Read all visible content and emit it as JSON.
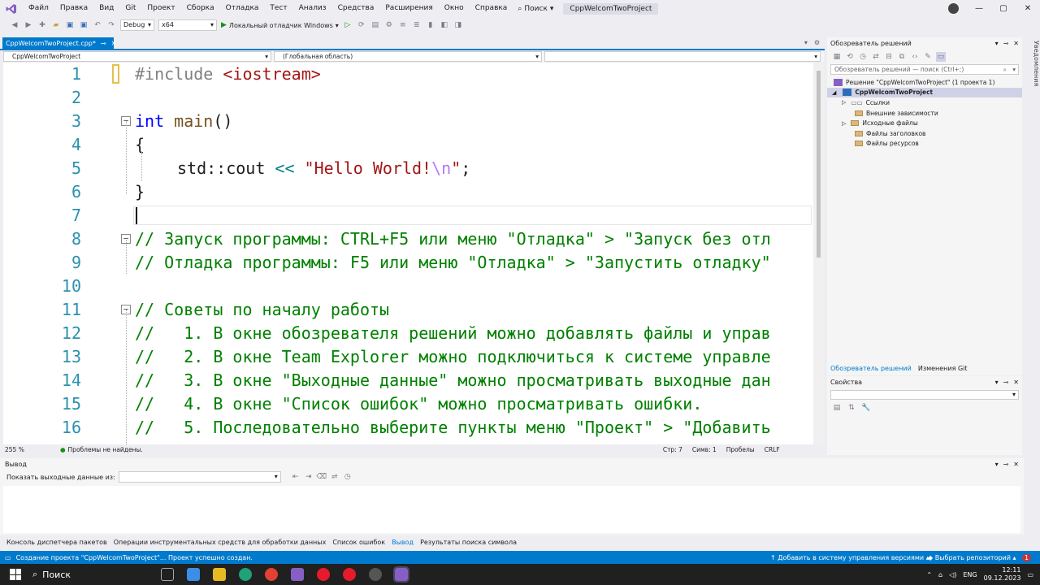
{
  "menu": {
    "items": [
      "Файл",
      "Правка",
      "Вид",
      "Git",
      "Проект",
      "Сборка",
      "Отладка",
      "Тест",
      "Анализ",
      "Средства",
      "Расширения",
      "Окно",
      "Справка"
    ],
    "search_label": "Поиск",
    "solution_title": "CppWelcomTwoProject"
  },
  "toolbar": {
    "config": "Debug",
    "platform": "x64",
    "run_label": "Локальный отладчик Windows"
  },
  "editor": {
    "tab_label": "CppWelcomTwoProject.cpp*",
    "nav_project": "CppWelcomTwoProject",
    "nav_scope": "(Глобальная область)",
    "lines": {
      "l1": {
        "num": "1",
        "pp": "#include ",
        "inc": "<iostream>"
      },
      "l2": {
        "num": "2"
      },
      "l3": {
        "num": "3",
        "kw": "int",
        "fn": "main",
        "rest": "()"
      },
      "l4": {
        "num": "4",
        "text": "{"
      },
      "l5": {
        "num": "5",
        "a": "std::cout ",
        "op": "<<",
        "s1": " \"Hello World!",
        "esc": "\\n",
        "s2": "\"",
        "end": ";"
      },
      "l6": {
        "num": "6",
        "text": "}"
      },
      "l7": {
        "num": "7"
      },
      "l8": {
        "num": "8",
        "text": "// Запуск программы: CTRL+F5 или меню \"Отладка\" > \"Запуск без отл"
      },
      "l9": {
        "num": "9",
        "text": "// Отладка программы: F5 или меню \"Отладка\" > \"Запустить отладку\""
      },
      "l10": {
        "num": "10"
      },
      "l11": {
        "num": "11",
        "text": "// Советы по началу работы"
      },
      "l12": {
        "num": "12",
        "text": "//   1. В окне обозревателя решений можно добавлять файлы и управ"
      },
      "l13": {
        "num": "13",
        "text": "//   2. В окне Team Explorer можно подключиться к системе управле"
      },
      "l14": {
        "num": "14",
        "text": "//   3. В окне \"Выходные данные\" можно просматривать выходные дан"
      },
      "l15": {
        "num": "15",
        "text": "//   4. В окне \"Список ошибок\" можно просматривать ошибки."
      },
      "l16": {
        "num": "16",
        "text": "//   5. Последовательно выберите пункты меню \"Проект\" > \"Добавить"
      }
    },
    "status": {
      "zoom": "255 %",
      "problems": "Проблемы не найдены.",
      "line": "Стр: 7",
      "col": "Симв: 1",
      "ws": "Пробелы",
      "eol": "CRLF"
    }
  },
  "solution_explorer": {
    "title": "Обозреватель решений",
    "search_placeholder": "Обозреватель решений — поиск (Ctrl+;)",
    "tree": {
      "solution": "Решение \"CppWelcomTwoProject\" (1 проекта 1)",
      "project": "CppWelcomTwoProject",
      "refs": "Ссылки",
      "ext": "Внешние зависимости",
      "src": "Исходные файлы",
      "hdr": "Файлы заголовков",
      "res": "Файлы ресурсов"
    },
    "tab_solution": "Обозреватель решений",
    "tab_git": "Изменения Git"
  },
  "properties": {
    "title": "Свойства"
  },
  "notifications": {
    "label": "Уведомления"
  },
  "output": {
    "title": "Вывод",
    "show_from": "Показать выходные данные из:"
  },
  "bottom_tabs": [
    "Консоль диспетчера пакетов",
    "Операции инструментальных средств для обработки данных",
    "Список ошибок",
    "Вывод",
    "Результаты поиска символа"
  ],
  "statusbar": {
    "message": "Создание проекта \"CppWelcomTwoProject\"... Проект успешно создан.",
    "add_vcs": "Добавить в систему управления версиями",
    "repo": "Выбрать репозиторий",
    "count": "1"
  },
  "taskbar": {
    "search": "Поиск",
    "lang": "ENG",
    "time": "12:11",
    "date": "09.12.2023"
  }
}
